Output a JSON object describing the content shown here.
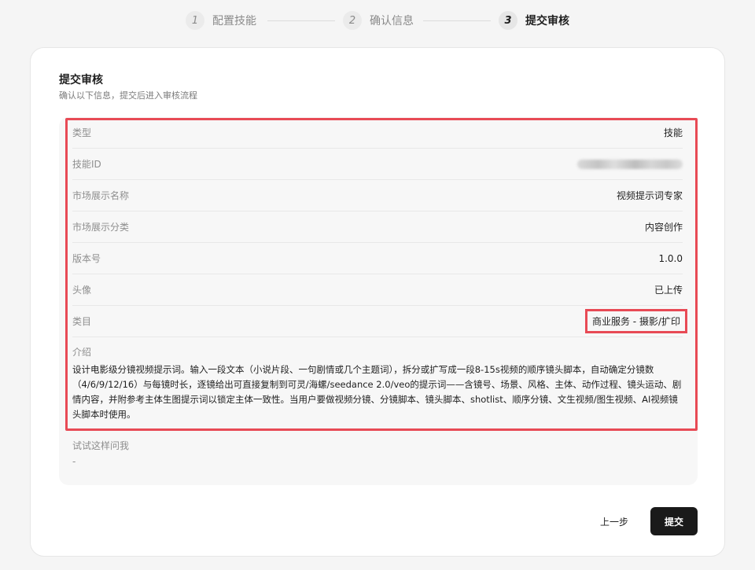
{
  "stepper": {
    "steps": [
      {
        "num": "1",
        "label": "配置技能"
      },
      {
        "num": "2",
        "label": "确认信息"
      },
      {
        "num": "3",
        "label": "提交审核"
      }
    ]
  },
  "card": {
    "title": "提交审核",
    "subtitle": "确认以下信息，提交后进入审核流程"
  },
  "info": {
    "rows": [
      {
        "key": "类型",
        "value": "技能"
      },
      {
        "key": "技能ID",
        "value": ""
      },
      {
        "key": "市场展示名称",
        "value": "视频提示词专家"
      },
      {
        "key": "市场展示分类",
        "value": "内容创作"
      },
      {
        "key": "版本号",
        "value": "1.0.0"
      },
      {
        "key": "头像",
        "value": "已上传"
      },
      {
        "key": "类目",
        "value": "商业服务 - 摄影/扩印"
      }
    ],
    "intro_label": "介绍",
    "intro_text": "设计电影级分镜视频提示词。输入一段文本（小说片段、一句剧情或几个主题词），拆分或扩写成一段8-15s视频的顺序镜头脚本，自动确定分镜数（4/6/9/12/16）与每镜时长，逐镜给出可直接复制到可灵/海螺/seedance 2.0/veo的提示词——含镜号、场景、风格、主体、动作过程、镜头运动、剧情内容，并附参考主体生图提示词以锁定主体一致性。当用户要做视频分镜、分镜脚本、镜头脚本、shotlist、顺序分镜、文生视频/图生视频、AI视频镜头脚本时使用。",
    "try_label": "试试这样问我",
    "try_value": "-"
  },
  "actions": {
    "prev_label": "上一步",
    "submit_label": "提交"
  }
}
